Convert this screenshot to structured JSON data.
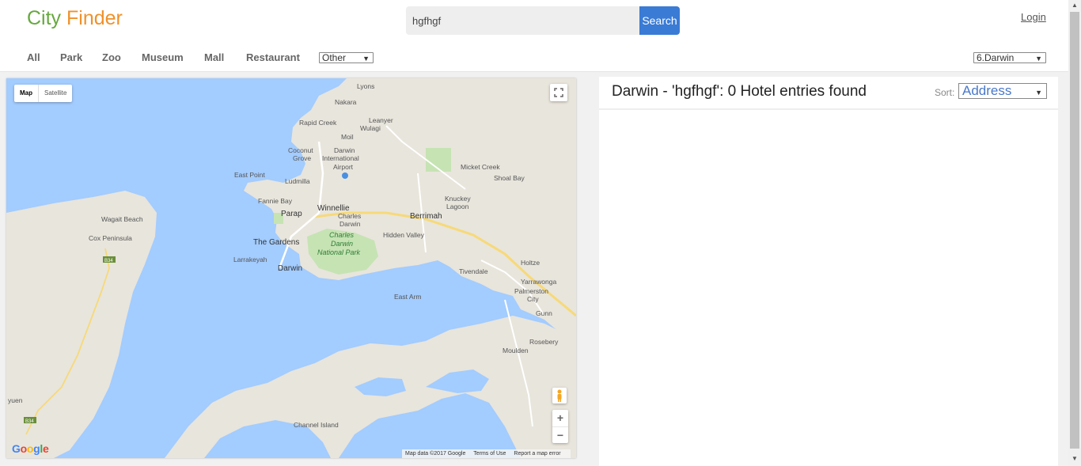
{
  "header": {
    "logo_word1": "City",
    "logo_word2": "Finder",
    "search_value": "hgfhgf",
    "search_button": "Search",
    "login": "Login"
  },
  "nav": {
    "items": [
      "All",
      "Park",
      "Zoo",
      "Museum",
      "Mall",
      "Restaurant"
    ],
    "other_select": "Other",
    "city_select": "6.Darwin"
  },
  "map": {
    "type_map": "Map",
    "type_satellite": "Satellite",
    "google": "Google",
    "attribution": [
      "Map data ©2017 Google",
      "Terms of Use",
      "Report a map error"
    ],
    "zoom_in": "+",
    "zoom_out": "−",
    "labels": {
      "lyons": "Lyons",
      "nakara": "Nakara",
      "leanyer": "Leanyer",
      "rapid_creek": "Rapid Creek",
      "wulagi": "Wulagi",
      "moil": "Moil",
      "coconut": "Coconut",
      "grove": "Grove",
      "darwin_intl_1": "Darwin",
      "darwin_intl_2": "International",
      "darwin_intl_3": "Airport",
      "east_point": "East Point",
      "ludmilla": "Ludmilla",
      "fannie_bay": "Fannie Bay",
      "parap": "Parap",
      "winnellie": "Winnellie",
      "charles_1": "Charles",
      "charles_2": "Darwin",
      "berrimah": "Berrimah",
      "knuckey_1": "Knuckey",
      "knuckey_2": "Lagoon",
      "micket_creek": "Micket Creek",
      "shoal_bay": "Shoal Bay",
      "wagait_beach": "Wagait Beach",
      "cox_peninsula": "Cox Peninsula",
      "the_gardens": "The Gardens",
      "hidden_valley": "Hidden Valley",
      "park_1": "Charles",
      "park_2": "Darwin",
      "park_3": "National Park",
      "larrakeyah": "Larrakeyah",
      "darwin": "Darwin",
      "holtze": "Holtze",
      "tivendale": "Tivendale",
      "yarrawonga": "Yarrawonga",
      "palmerston_1": "Palmerston",
      "palmerston_2": "City",
      "east_arm": "East Arm",
      "gunn": "Gunn",
      "rosebery": "Rosebery",
      "moulden": "Moulden",
      "channel_island": "Channel Island",
      "yuen": "yuen",
      "b34a": "B34",
      "b34b": "B34"
    }
  },
  "results": {
    "title": "Darwin - 'hgfhgf': 0 Hotel entries found",
    "sort_label": "Sort:",
    "sort_value": "Address"
  }
}
